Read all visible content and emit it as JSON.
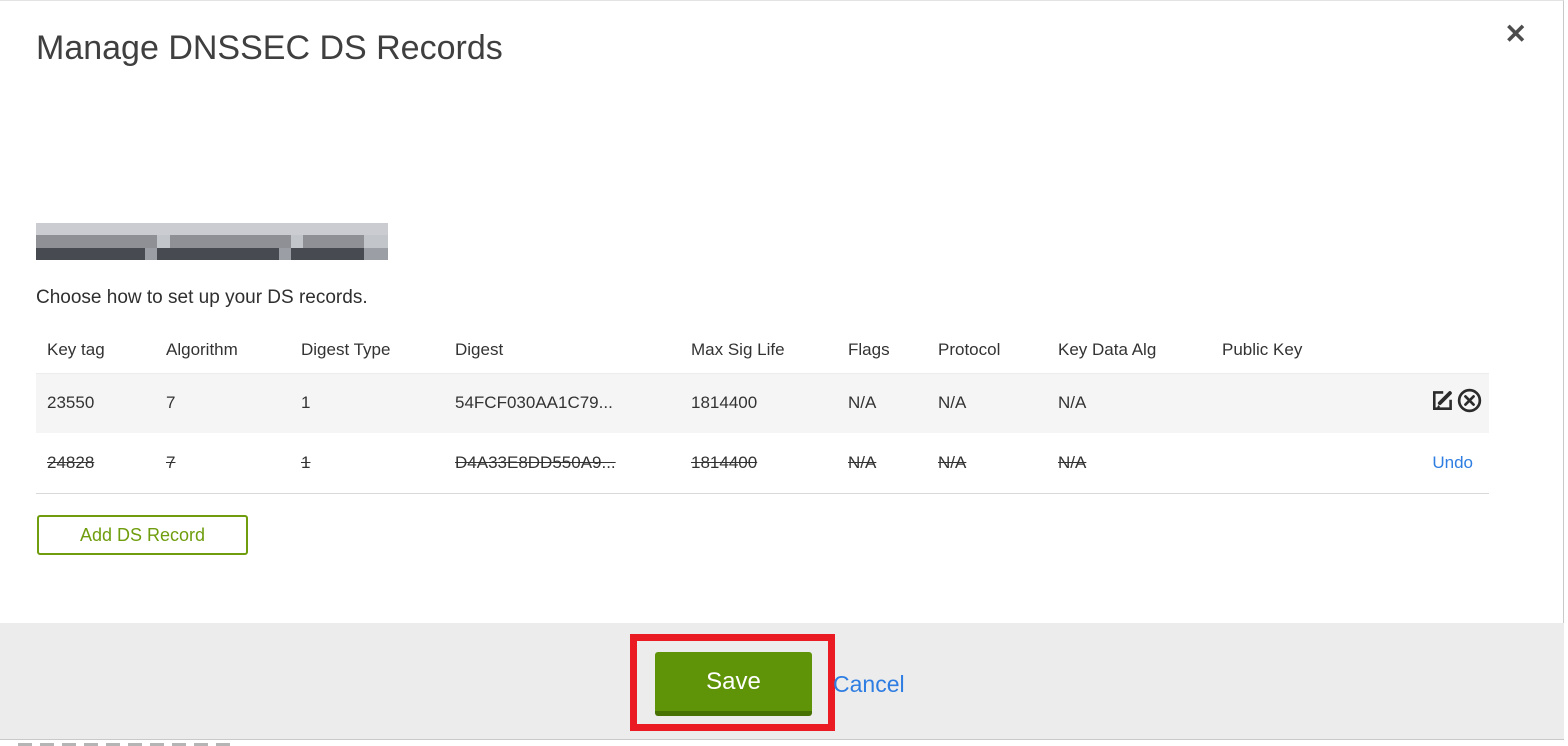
{
  "modal": {
    "title": "Manage DNSSEC DS Records",
    "close_label": "✕",
    "instruction": "Choose how to set up your DS records.",
    "add_button_label": "Add DS Record",
    "save_label": "Save",
    "cancel_label": "Cancel",
    "undo_label": "Undo"
  },
  "table": {
    "columns": [
      "Key tag",
      "Algorithm",
      "Digest Type",
      "Digest",
      "Max Sig Life",
      "Flags",
      "Protocol",
      "Key Data Alg",
      "Public Key"
    ],
    "rows": [
      {
        "state": "normal",
        "cells": [
          "23550",
          "7",
          "1",
          "54FCF030AA1C79...",
          "1814400",
          "N/A",
          "N/A",
          "N/A",
          ""
        ]
      },
      {
        "state": "deleted",
        "cells": [
          "24828",
          "7",
          "1",
          "D4A33E8DD550A9...",
          "1814400",
          "N/A",
          "N/A",
          "N/A",
          ""
        ]
      }
    ]
  },
  "colors": {
    "accent_green": "#5f9408",
    "green_dark": "#487103",
    "outline_green": "#6f9d0d",
    "link_blue": "#2e7de2",
    "annotation_red": "#ea1b22"
  }
}
